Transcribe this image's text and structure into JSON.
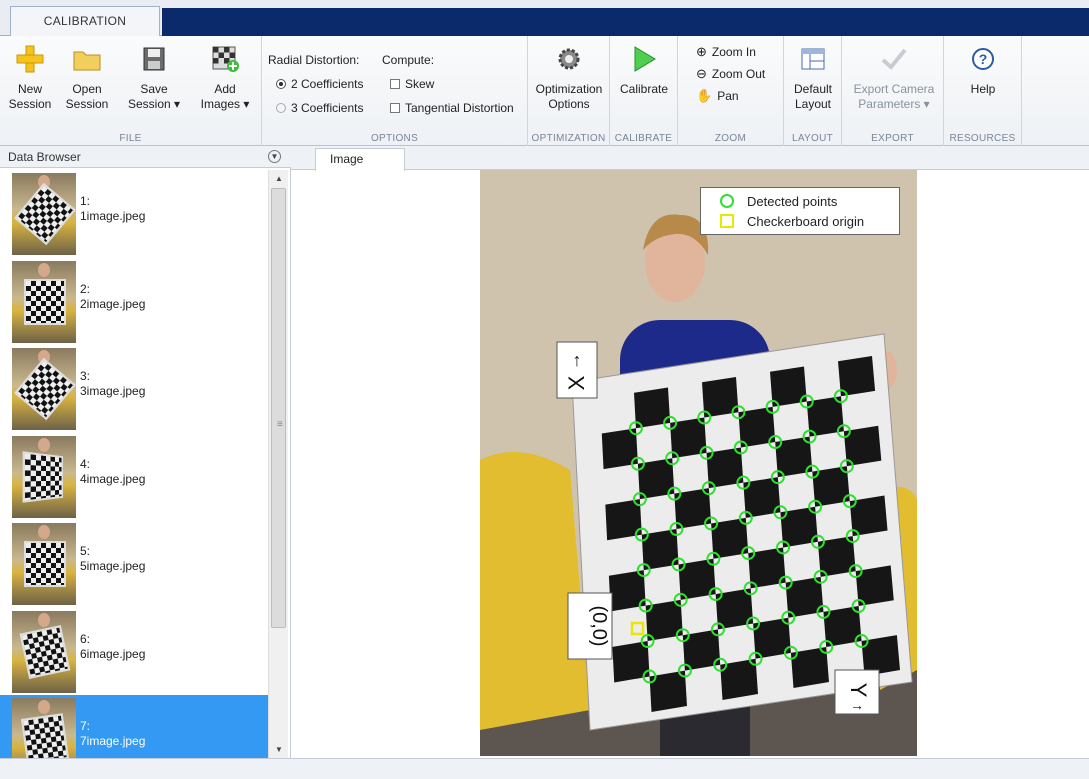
{
  "tabs": {
    "calibration": "CALIBRATION"
  },
  "ribbon": {
    "file": {
      "label": "FILE",
      "new_session": [
        "New",
        "Session"
      ],
      "open_session": [
        "Open",
        "Session"
      ],
      "save_session": [
        "Save",
        "Session ▾"
      ],
      "add_images": [
        "Add",
        "Images ▾"
      ]
    },
    "options": {
      "label": "OPTIONS",
      "radial_title": "Radial Distortion:",
      "compute_title": "Compute:",
      "two_coeff": "2 Coefficients",
      "three_coeff": "3 Coefficients",
      "skew": "Skew",
      "tangential": "Tangential Distortion"
    },
    "optimization": {
      "label": "OPTIMIZATION",
      "button": [
        "Optimization",
        "Options"
      ]
    },
    "calibrate": {
      "label": "CALIBRATE",
      "button": "Calibrate"
    },
    "zoom": {
      "label": "ZOOM",
      "zoom_in": "Zoom In",
      "zoom_out": "Zoom Out",
      "pan": "Pan"
    },
    "layout": {
      "label": "LAYOUT",
      "button": [
        "Default",
        "Layout"
      ]
    },
    "export": {
      "label": "EXPORT",
      "button": [
        "Export Camera",
        "Parameters ▾"
      ]
    },
    "resources": {
      "label": "RESOURCES",
      "button": "Help"
    }
  },
  "browser": {
    "title": "Data Browser",
    "items": [
      {
        "num": "1:",
        "name": "1image.jpeg"
      },
      {
        "num": "2:",
        "name": "2image.jpeg"
      },
      {
        "num": "3:",
        "name": "3image.jpeg"
      },
      {
        "num": "4:",
        "name": "4image.jpeg"
      },
      {
        "num": "5:",
        "name": "5image.jpeg"
      },
      {
        "num": "6:",
        "name": "6image.jpeg"
      },
      {
        "num": "7:",
        "name": "7image.jpeg"
      }
    ]
  },
  "image_panel": {
    "tab": "Image",
    "legend": {
      "detected": "Detected points",
      "origin": "Checkerboard origin"
    },
    "labels": {
      "x": "X",
      "y": "Y",
      "origin": "(0,0)"
    }
  },
  "colors": {
    "detected": "#2ee02e",
    "origin": "#e8e800",
    "selection": "#3399f3",
    "accent_dark": "#0a2a6c"
  }
}
